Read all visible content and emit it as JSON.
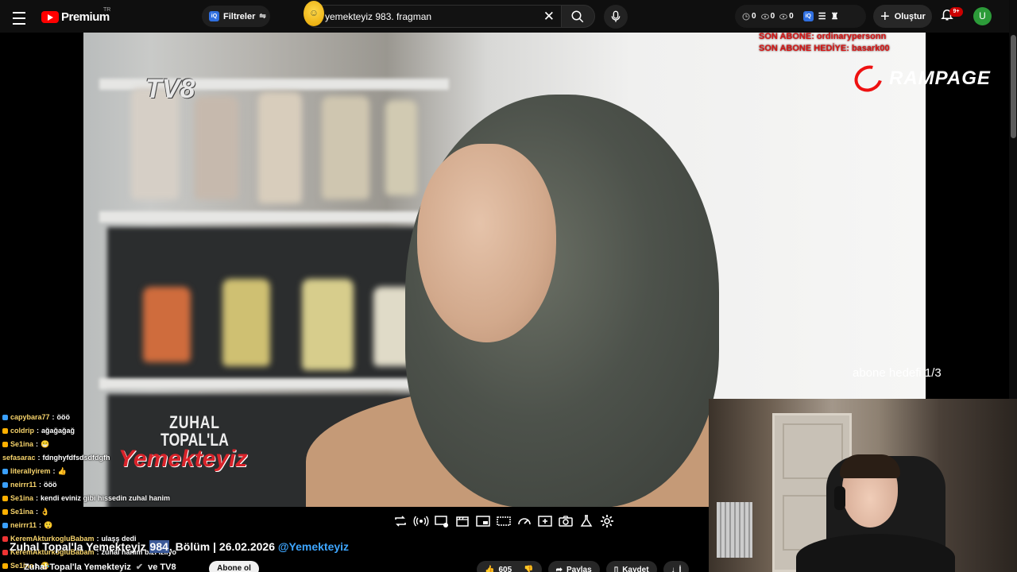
{
  "header": {
    "logo_text": "Premium",
    "region": "TR",
    "filters_label": "Filtreler",
    "filters_badge": "iQ",
    "search_value": "yemekteyiz 983. fragman",
    "stats": [
      "0",
      "0",
      "0"
    ],
    "stats_badge": "iQ",
    "create_label": "Oluştur",
    "notifications_badge": "9+",
    "avatar_initial": "U"
  },
  "video": {
    "channel_logo": "TV8",
    "show_logo": {
      "line1": "ZUHAL",
      "line2": "TOPAL'LA",
      "line3": "Yemekteyiz"
    },
    "overlay_sub_lines": [
      "SON ABONE: ordinarypersonn",
      "SON ABONE HEDİYE: basark00"
    ],
    "sponsor": "RAMPAGE",
    "sub_goal": "abone hedefi 1/3"
  },
  "chat": [
    {
      "user": "capybara77",
      "msg": "ööö",
      "badge": "#3aa0ff"
    },
    {
      "user": "coldrip",
      "msg": "ağağağağ",
      "badge": "#ffb000"
    },
    {
      "user": "Se1ina",
      "msg": "😁",
      "badge": "#ffb000"
    },
    {
      "user": "sefasarac",
      "msg": "fdnghyfdfsdsdfdgfh",
      "badge": ""
    },
    {
      "user": "literallyirem",
      "msg": "👍",
      "badge": "#3aa0ff"
    },
    {
      "user": "neirrr11",
      "msg": "ööö",
      "badge": "#3aa0ff"
    },
    {
      "user": "Se1ina",
      "msg": "kendi eviniz gibi hissedin zuhal hanim",
      "badge": "#ffb000"
    },
    {
      "user": "Se1ina",
      "msg": "👌",
      "badge": "#ffb000"
    },
    {
      "user": "neirrr11",
      "msg": "😲",
      "badge": "#3aa0ff"
    },
    {
      "user": "KeremAkturkogluBabam",
      "msg": "ulaşş dedi",
      "badge": "#e33"
    },
    {
      "user": "KeremAkturkogluBabam",
      "msg": "zuhal hanım bizi izliyo",
      "badge": "#e33"
    },
    {
      "user": "Se1ina",
      "msg": "😂",
      "badge": "#ffb000"
    }
  ],
  "meta": {
    "title_prefix": "Zuhal Topal'la Yemekteyiz ",
    "title_highlight": "984",
    "title_suffix": ". Bölüm | 26.02.2026 ",
    "title_mention": "@Yemekteyiz",
    "channel_name": "Zuhal Topal'la Yemekteyiz",
    "channel_and": "ve TV8",
    "subscribe_label": "Abone ol",
    "likes": "605",
    "share_label": "Paylaş",
    "save_label": "Kaydet",
    "download_label": "İ"
  }
}
